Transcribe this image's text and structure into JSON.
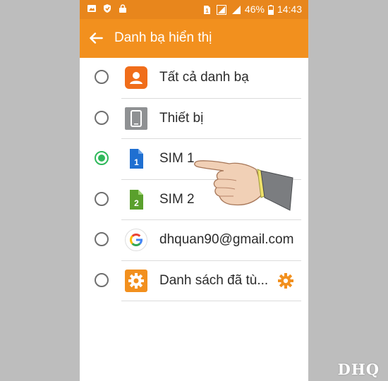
{
  "status_bar": {
    "battery_percent": "46%",
    "time": "14:43",
    "icons": [
      "gallery-icon",
      "shield-icon",
      "lock-icon",
      "sim-1-icon",
      "signal-icon",
      "signal-icon",
      "battery-icon"
    ]
  },
  "app_bar": {
    "title": "Danh bạ hiển thị",
    "back_icon": "arrow-left-icon"
  },
  "options": [
    {
      "label": "Tất cả danh bạ",
      "icon": "contacts-icon",
      "selected": false
    },
    {
      "label": "Thiết bị",
      "icon": "device-icon",
      "selected": false
    },
    {
      "label": "SIM 1",
      "icon": "sim-1-icon",
      "selected": true
    },
    {
      "label": "SIM 2",
      "icon": "sim-2-icon",
      "selected": false
    },
    {
      "label": "dhquan90@gmail.com",
      "icon": "google-icon",
      "selected": false
    },
    {
      "label": "Danh sách đã tù...",
      "icon": "settings-icon",
      "selected": false,
      "trailing_icon": "gear-icon"
    }
  ],
  "colors": {
    "status_bar": "#e8861c",
    "app_bar": "#f2901e",
    "radio_selected": "#2fb85a"
  },
  "watermark": "DHQ"
}
